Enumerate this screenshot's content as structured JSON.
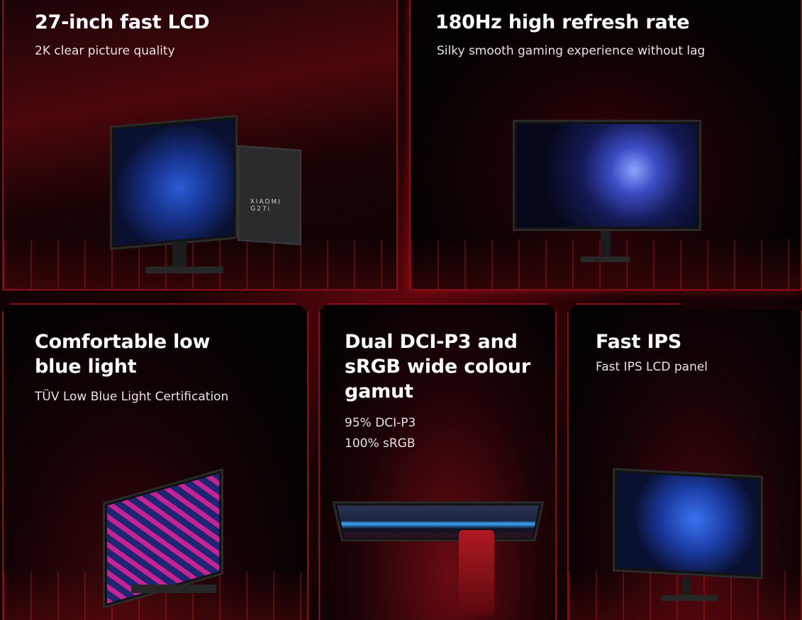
{
  "cards": {
    "lcd": {
      "title": "27-inch fast LCD",
      "subtitle": "2K clear picture quality",
      "brand_on_monitor": "XIAOMI G27i"
    },
    "refresh": {
      "title": "180Hz high refresh rate",
      "subtitle": "Silky smooth gaming experience without lag"
    },
    "blue_light": {
      "title": "Comfortable low blue light",
      "subtitle": "TÜV Low Blue Light Certification"
    },
    "gamut": {
      "title": "Dual DCI-P3 and sRGB wide colour gamut",
      "line1": "95% DCI-P3",
      "line2": "100% sRGB"
    },
    "ips": {
      "title": "Fast IPS",
      "subtitle": "Fast IPS LCD panel"
    }
  },
  "colors": {
    "accent_red": "#8a0e17",
    "background": "#120204",
    "text": "#ffffff"
  }
}
